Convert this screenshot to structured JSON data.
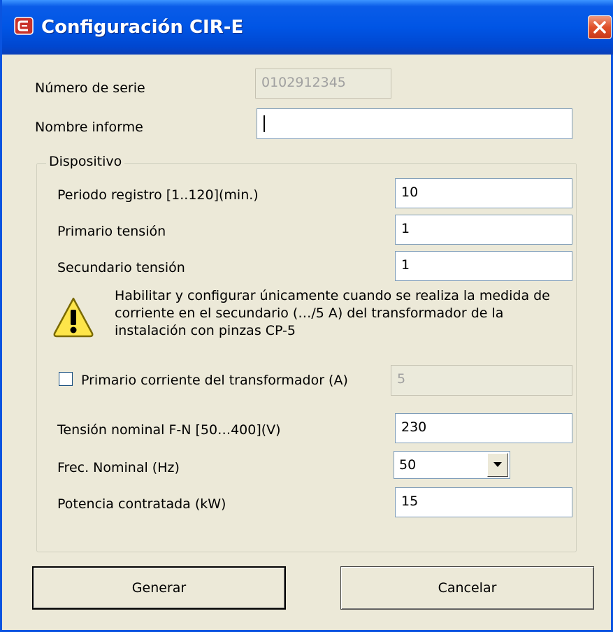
{
  "window": {
    "title": "Configuración CIR-E",
    "accent_color": "#0055e5",
    "icon": "app-logo-icon"
  },
  "form": {
    "serial_label": "Número de serie",
    "serial_value": "0102912345",
    "report_name_label": "Nombre informe",
    "report_name_value": ""
  },
  "device": {
    "group_title": "Dispositivo",
    "period_label": "Periodo registro [1..120](min.)",
    "period_value": "10",
    "primary_voltage_label": "Primario tensión",
    "primary_voltage_value": "1",
    "secondary_voltage_label": "Secundario tensión",
    "secondary_voltage_value": "1",
    "warning_line1": "Habilitar y configurar únicamente cuando se realiza la medida de",
    "warning_line2": "corriente en el secundario (…/5 A) del transformador de la",
    "warning_line3": "instalación con pinzas CP-5",
    "warning_icon": "warning-icon",
    "transformer_current_label": "Primario corriente del transformador (A)",
    "transformer_current_checked": false,
    "transformer_current_value": "5",
    "nominal_voltage_label": "Tensión nominal  F-N [50…400](V)",
    "nominal_voltage_value": "230",
    "nominal_freq_label": "Frec. Nominal (Hz)",
    "nominal_freq_value": "50",
    "contracted_power_label": "Potencia contratada (kW)",
    "contracted_power_value": "15"
  },
  "buttons": {
    "generate": "Generar",
    "cancel": "Cancelar"
  }
}
